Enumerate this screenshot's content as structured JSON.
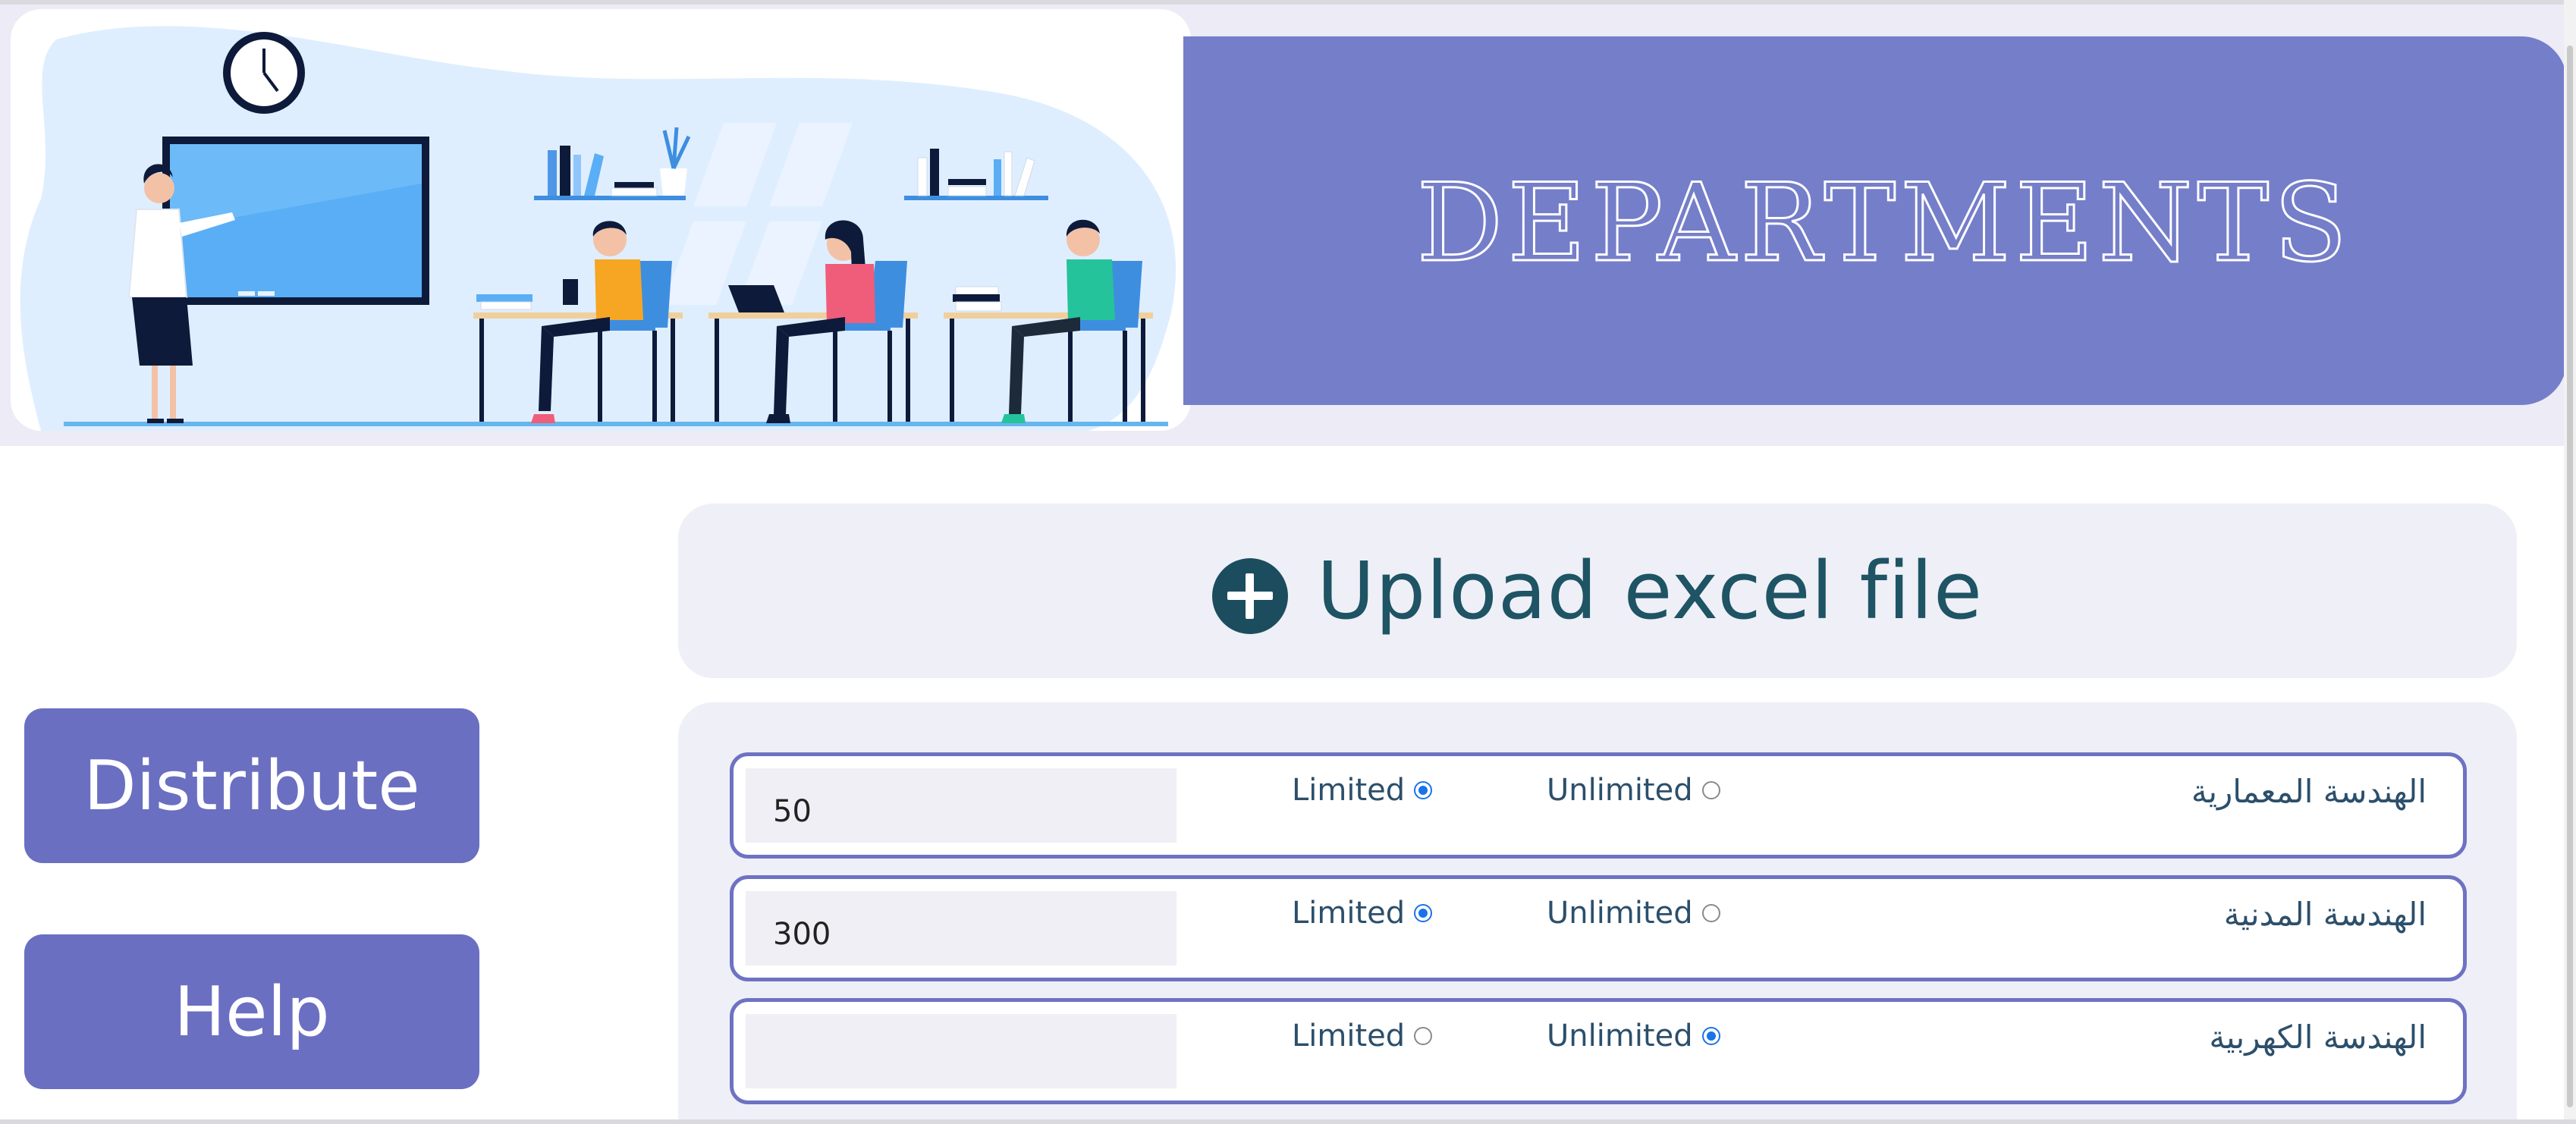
{
  "header": {
    "title": "DEPARTMENTS",
    "illustration": "classroom-illustration"
  },
  "upload": {
    "label": "Upload excel file",
    "icon": "plus-circle-icon"
  },
  "sidebar": {
    "distribute_label": "Distribute",
    "help_label": "Help"
  },
  "departments": [
    {
      "name": "الهندسة المعمارية",
      "value": "50",
      "limited_label": "Limited",
      "unlimited_label": "Unlimited",
      "mode": "limited"
    },
    {
      "name": "الهندسة المدنية",
      "value": "300",
      "limited_label": "Limited",
      "unlimited_label": "Unlimited",
      "mode": "limited"
    },
    {
      "name": "الهندسة الكهربية",
      "value": "",
      "limited_label": "Limited",
      "unlimited_label": "Unlimited",
      "mode": "unlimited"
    }
  ],
  "colors": {
    "banner": "#757ec9",
    "buttons": "#6a6fc1",
    "panel": "#efeff7",
    "accent_text": "#1e5464"
  }
}
